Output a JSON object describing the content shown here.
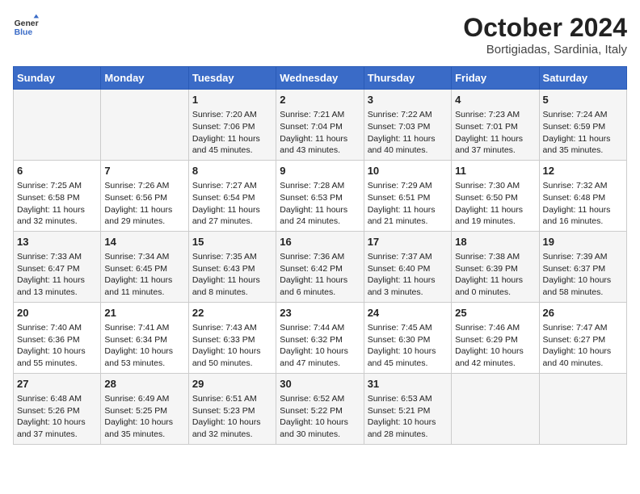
{
  "header": {
    "logo_line1": "General",
    "logo_line2": "Blue",
    "title": "October 2024",
    "subtitle": "Bortigiadas, Sardinia, Italy"
  },
  "columns": [
    "Sunday",
    "Monday",
    "Tuesday",
    "Wednesday",
    "Thursday",
    "Friday",
    "Saturday"
  ],
  "weeks": [
    [
      {
        "day": "",
        "sunrise": "",
        "sunset": "",
        "daylight": ""
      },
      {
        "day": "",
        "sunrise": "",
        "sunset": "",
        "daylight": ""
      },
      {
        "day": "1",
        "sunrise": "Sunrise: 7:20 AM",
        "sunset": "Sunset: 7:06 PM",
        "daylight": "Daylight: 11 hours and 45 minutes."
      },
      {
        "day": "2",
        "sunrise": "Sunrise: 7:21 AM",
        "sunset": "Sunset: 7:04 PM",
        "daylight": "Daylight: 11 hours and 43 minutes."
      },
      {
        "day": "3",
        "sunrise": "Sunrise: 7:22 AM",
        "sunset": "Sunset: 7:03 PM",
        "daylight": "Daylight: 11 hours and 40 minutes."
      },
      {
        "day": "4",
        "sunrise": "Sunrise: 7:23 AM",
        "sunset": "Sunset: 7:01 PM",
        "daylight": "Daylight: 11 hours and 37 minutes."
      },
      {
        "day": "5",
        "sunrise": "Sunrise: 7:24 AM",
        "sunset": "Sunset: 6:59 PM",
        "daylight": "Daylight: 11 hours and 35 minutes."
      }
    ],
    [
      {
        "day": "6",
        "sunrise": "Sunrise: 7:25 AM",
        "sunset": "Sunset: 6:58 PM",
        "daylight": "Daylight: 11 hours and 32 minutes."
      },
      {
        "day": "7",
        "sunrise": "Sunrise: 7:26 AM",
        "sunset": "Sunset: 6:56 PM",
        "daylight": "Daylight: 11 hours and 29 minutes."
      },
      {
        "day": "8",
        "sunrise": "Sunrise: 7:27 AM",
        "sunset": "Sunset: 6:54 PM",
        "daylight": "Daylight: 11 hours and 27 minutes."
      },
      {
        "day": "9",
        "sunrise": "Sunrise: 7:28 AM",
        "sunset": "Sunset: 6:53 PM",
        "daylight": "Daylight: 11 hours and 24 minutes."
      },
      {
        "day": "10",
        "sunrise": "Sunrise: 7:29 AM",
        "sunset": "Sunset: 6:51 PM",
        "daylight": "Daylight: 11 hours and 21 minutes."
      },
      {
        "day": "11",
        "sunrise": "Sunrise: 7:30 AM",
        "sunset": "Sunset: 6:50 PM",
        "daylight": "Daylight: 11 hours and 19 minutes."
      },
      {
        "day": "12",
        "sunrise": "Sunrise: 7:32 AM",
        "sunset": "Sunset: 6:48 PM",
        "daylight": "Daylight: 11 hours and 16 minutes."
      }
    ],
    [
      {
        "day": "13",
        "sunrise": "Sunrise: 7:33 AM",
        "sunset": "Sunset: 6:47 PM",
        "daylight": "Daylight: 11 hours and 13 minutes."
      },
      {
        "day": "14",
        "sunrise": "Sunrise: 7:34 AM",
        "sunset": "Sunset: 6:45 PM",
        "daylight": "Daylight: 11 hours and 11 minutes."
      },
      {
        "day": "15",
        "sunrise": "Sunrise: 7:35 AM",
        "sunset": "Sunset: 6:43 PM",
        "daylight": "Daylight: 11 hours and 8 minutes."
      },
      {
        "day": "16",
        "sunrise": "Sunrise: 7:36 AM",
        "sunset": "Sunset: 6:42 PM",
        "daylight": "Daylight: 11 hours and 6 minutes."
      },
      {
        "day": "17",
        "sunrise": "Sunrise: 7:37 AM",
        "sunset": "Sunset: 6:40 PM",
        "daylight": "Daylight: 11 hours and 3 minutes."
      },
      {
        "day": "18",
        "sunrise": "Sunrise: 7:38 AM",
        "sunset": "Sunset: 6:39 PM",
        "daylight": "Daylight: 11 hours and 0 minutes."
      },
      {
        "day": "19",
        "sunrise": "Sunrise: 7:39 AM",
        "sunset": "Sunset: 6:37 PM",
        "daylight": "Daylight: 10 hours and 58 minutes."
      }
    ],
    [
      {
        "day": "20",
        "sunrise": "Sunrise: 7:40 AM",
        "sunset": "Sunset: 6:36 PM",
        "daylight": "Daylight: 10 hours and 55 minutes."
      },
      {
        "day": "21",
        "sunrise": "Sunrise: 7:41 AM",
        "sunset": "Sunset: 6:34 PM",
        "daylight": "Daylight: 10 hours and 53 minutes."
      },
      {
        "day": "22",
        "sunrise": "Sunrise: 7:43 AM",
        "sunset": "Sunset: 6:33 PM",
        "daylight": "Daylight: 10 hours and 50 minutes."
      },
      {
        "day": "23",
        "sunrise": "Sunrise: 7:44 AM",
        "sunset": "Sunset: 6:32 PM",
        "daylight": "Daylight: 10 hours and 47 minutes."
      },
      {
        "day": "24",
        "sunrise": "Sunrise: 7:45 AM",
        "sunset": "Sunset: 6:30 PM",
        "daylight": "Daylight: 10 hours and 45 minutes."
      },
      {
        "day": "25",
        "sunrise": "Sunrise: 7:46 AM",
        "sunset": "Sunset: 6:29 PM",
        "daylight": "Daylight: 10 hours and 42 minutes."
      },
      {
        "day": "26",
        "sunrise": "Sunrise: 7:47 AM",
        "sunset": "Sunset: 6:27 PM",
        "daylight": "Daylight: 10 hours and 40 minutes."
      }
    ],
    [
      {
        "day": "27",
        "sunrise": "Sunrise: 6:48 AM",
        "sunset": "Sunset: 5:26 PM",
        "daylight": "Daylight: 10 hours and 37 minutes."
      },
      {
        "day": "28",
        "sunrise": "Sunrise: 6:49 AM",
        "sunset": "Sunset: 5:25 PM",
        "daylight": "Daylight: 10 hours and 35 minutes."
      },
      {
        "day": "29",
        "sunrise": "Sunrise: 6:51 AM",
        "sunset": "Sunset: 5:23 PM",
        "daylight": "Daylight: 10 hours and 32 minutes."
      },
      {
        "day": "30",
        "sunrise": "Sunrise: 6:52 AM",
        "sunset": "Sunset: 5:22 PM",
        "daylight": "Daylight: 10 hours and 30 minutes."
      },
      {
        "day": "31",
        "sunrise": "Sunrise: 6:53 AM",
        "sunset": "Sunset: 5:21 PM",
        "daylight": "Daylight: 10 hours and 28 minutes."
      },
      {
        "day": "",
        "sunrise": "",
        "sunset": "",
        "daylight": ""
      },
      {
        "day": "",
        "sunrise": "",
        "sunset": "",
        "daylight": ""
      }
    ]
  ]
}
